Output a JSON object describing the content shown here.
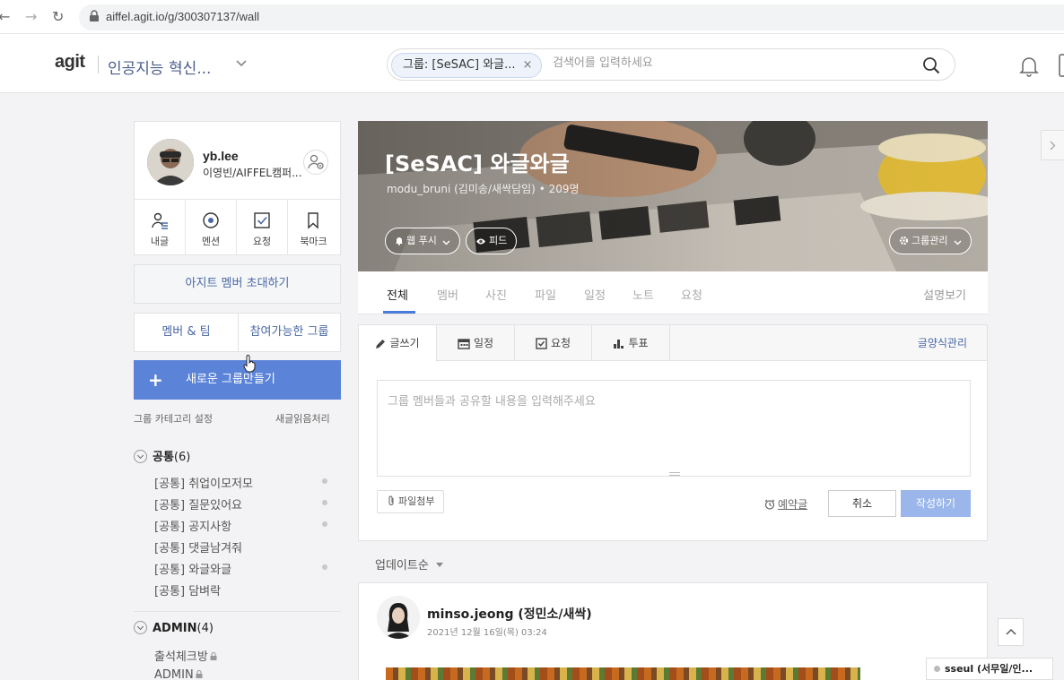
{
  "browser": {
    "back": "←",
    "forward": "→",
    "reload": "↻",
    "url": "aiffel.agit.io/g/300307137/wall"
  },
  "header": {
    "logo": "agit",
    "group_name": "인공지능 혁신...",
    "search_chip": "그룹: [SeSAC] 와글...",
    "search_chip_close": "×",
    "search_placeholder": "검색어를 입력하세요"
  },
  "profile": {
    "name": "yb.lee",
    "subtitle": "이영빈/AIFFEL캠퍼...",
    "quick": [
      {
        "label": "내글",
        "icon": "my-posts-icon"
      },
      {
        "label": "멘션",
        "icon": "mention-icon"
      },
      {
        "label": "요청",
        "icon": "request-icon"
      },
      {
        "label": "북마크",
        "icon": "bookmark-icon"
      }
    ]
  },
  "sidebar": {
    "invite": "아지트 멤버 초대하기",
    "tab_members": "멤버 & 팀",
    "tab_groups": "참여가능한 그룹",
    "new_group_plus": "+",
    "new_group": "새로운 그룹만들기",
    "category_setting": "그룹 카테고리 설정",
    "mark_read": "새글읽음처리",
    "categories": [
      {
        "name": "공통",
        "count": "(6)",
        "items": [
          {
            "label": "[공통] 취업이모저모",
            "dot": true
          },
          {
            "label": "[공통] 질문있어요",
            "dot": true
          },
          {
            "label": "[공통] 공지사항",
            "dot": true
          },
          {
            "label": "[공통] 댓글남겨줘",
            "dot": false
          },
          {
            "label": "[공통] 와글와글",
            "dot": true
          },
          {
            "label": "[공통] 담벼락",
            "dot": false
          }
        ]
      },
      {
        "name": "ADMIN",
        "count": "(4)",
        "items": [
          {
            "label": "출석체크방",
            "lock": true
          },
          {
            "label": "ADMIN",
            "lock": true
          }
        ]
      }
    ]
  },
  "cover": {
    "title": "[SeSAC] 와글와글",
    "subtitle": "modu_bruni (김미송/새싹담임)",
    "member_count": "• 209명",
    "web_push": "웹 푸시",
    "feed": "피드",
    "group_manage": "그룹관리"
  },
  "group_tabs": {
    "items": [
      "전체",
      "멤버",
      "사진",
      "파일",
      "일정",
      "노트",
      "요청"
    ],
    "description": "설명보기"
  },
  "composer": {
    "tabs": [
      "글쓰기",
      "일정",
      "요청",
      "투표"
    ],
    "form_manage": "글양식관리",
    "placeholder": "그룹 멤버들과 공유할 내용을 입력해주세요",
    "attach": "파일첨부",
    "reserve": "예약글",
    "cancel": "취소",
    "submit": "작성하기"
  },
  "feed": {
    "sort": "업데이트순",
    "post": {
      "author": "minso.jeong (정민소/새싹)",
      "date": "2021년 12월 16일(목) 03:24"
    }
  },
  "chat": {
    "label": "sseul (서무일/인..."
  },
  "colors": {
    "accent": "#5b84d8",
    "link": "#4a68a6",
    "tab_underline": "#4a7bd8"
  }
}
